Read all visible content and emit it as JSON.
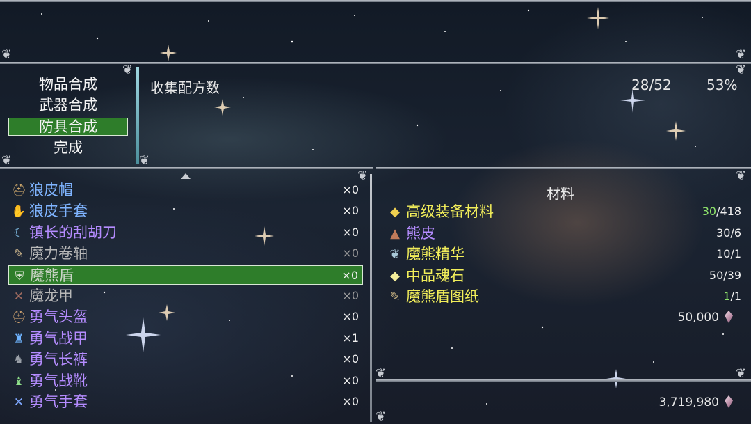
{
  "categories": {
    "items": [
      {
        "label": "物品合成",
        "selected": false
      },
      {
        "label": "武器合成",
        "selected": false
      },
      {
        "label": "防具合成",
        "selected": true
      },
      {
        "label": "完成",
        "selected": false
      }
    ]
  },
  "stats": {
    "label": "收集配方数",
    "count": "28/52",
    "percent": "53%"
  },
  "recipes": [
    {
      "name": "狼皮帽",
      "count": "×0",
      "icon": "wolf-helmet-icon",
      "color": "blue",
      "selected": false
    },
    {
      "name": "狼皮手套",
      "count": "×0",
      "icon": "wolf-gloves-icon",
      "color": "blue",
      "selected": false
    },
    {
      "name": "镇长的刮胡刀",
      "count": "×0",
      "icon": "razor-icon",
      "color": "purple",
      "selected": false
    },
    {
      "name": "魔力卷轴",
      "count": "×0",
      "icon": "scroll-icon",
      "color": "gray",
      "selected": false
    },
    {
      "name": "魔熊盾",
      "count": "×0",
      "icon": "bear-shield-icon",
      "color": "gray",
      "selected": true
    },
    {
      "name": "魔龙甲",
      "count": "×0",
      "icon": "dragon-armor-icon",
      "color": "gray",
      "selected": false
    },
    {
      "name": "勇气头盔",
      "count": "×0",
      "icon": "courage-helmet-icon",
      "color": "purple",
      "selected": false
    },
    {
      "name": "勇气战甲",
      "count": "×1",
      "icon": "courage-armor-icon",
      "color": "purple",
      "selected": false
    },
    {
      "name": "勇气长裤",
      "count": "×0",
      "icon": "courage-pants-icon",
      "color": "purple",
      "selected": false
    },
    {
      "name": "勇气战靴",
      "count": "×0",
      "icon": "courage-boots-icon",
      "color": "purple",
      "selected": false
    },
    {
      "name": "勇气手套",
      "count": "×0",
      "icon": "courage-gloves-icon",
      "color": "purple",
      "selected": false
    }
  ],
  "materials": {
    "header": "材料",
    "items": [
      {
        "name": "高级装备材料",
        "have": "30",
        "need": "/418",
        "icon": "gold-ore-icon",
        "name_color": "yellow",
        "have_color": "green"
      },
      {
        "name": "熊皮",
        "have": "30",
        "need": "/6",
        "icon": "bear-hide-icon",
        "name_color": "purple",
        "have_color": "white"
      },
      {
        "name": "魔熊精华",
        "have": "10",
        "need": "/1",
        "icon": "essence-icon",
        "name_color": "yellow",
        "have_color": "white"
      },
      {
        "name": "中品魂石",
        "have": "50",
        "need": "/39",
        "icon": "soul-stone-icon",
        "name_color": "yellow",
        "have_color": "white"
      },
      {
        "name": "魔熊盾图纸",
        "have": "1",
        "need": "/1",
        "icon": "blueprint-icon",
        "name_color": "yellow",
        "have_color": "green"
      }
    ],
    "cost": "50,000"
  },
  "wallet": {
    "amount": "3,719,980"
  },
  "colors": {
    "selected_bg": "#2e7d2a",
    "purple": "#b58cff",
    "yellow": "#f2ee5a",
    "green": "#8ee36b",
    "frame": "#b9bec6"
  }
}
